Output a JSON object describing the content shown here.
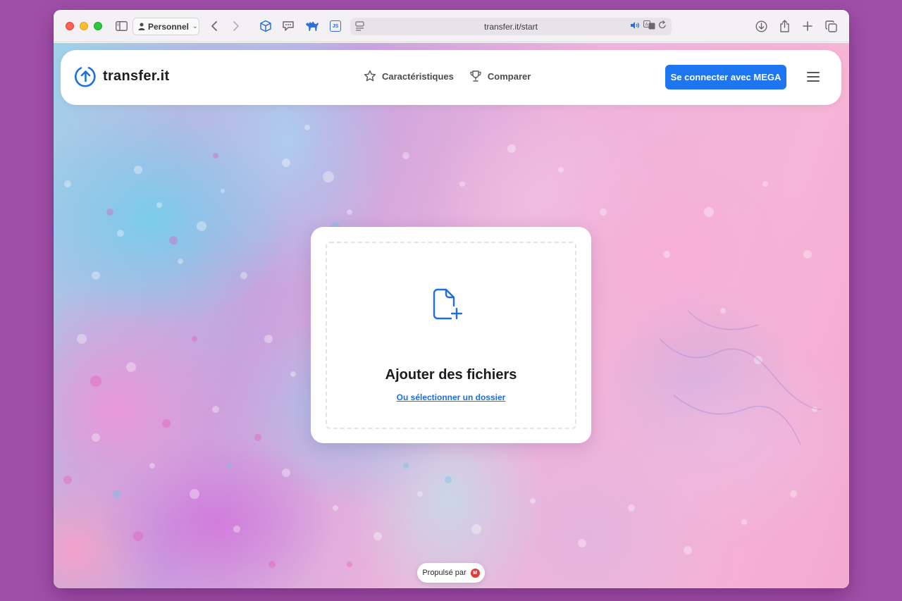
{
  "browser": {
    "profile_label": "Personnel",
    "url": "transfer.it/start",
    "extensions": [
      "cube-icon",
      "speech-bubble-icon",
      "camel-icon",
      "js-icon"
    ]
  },
  "header": {
    "logo_text": "transfer.it",
    "nav": [
      {
        "label": "Caractéristiques",
        "icon": "star-icon"
      },
      {
        "label": "Comparer",
        "icon": "trophy-icon"
      }
    ],
    "cta_label": "Se connecter avec MEGA"
  },
  "upload": {
    "title": "Ajouter des fichiers",
    "folder_link": "Ou sélectionner un dossier"
  },
  "footer": {
    "powered_label": "Propulsé par",
    "mega_letter": "M"
  },
  "colors": {
    "accent": "#1e75f0",
    "link": "#1e6fe0",
    "mega_red": "#e53a3a",
    "desktop": "#a04fa8"
  }
}
